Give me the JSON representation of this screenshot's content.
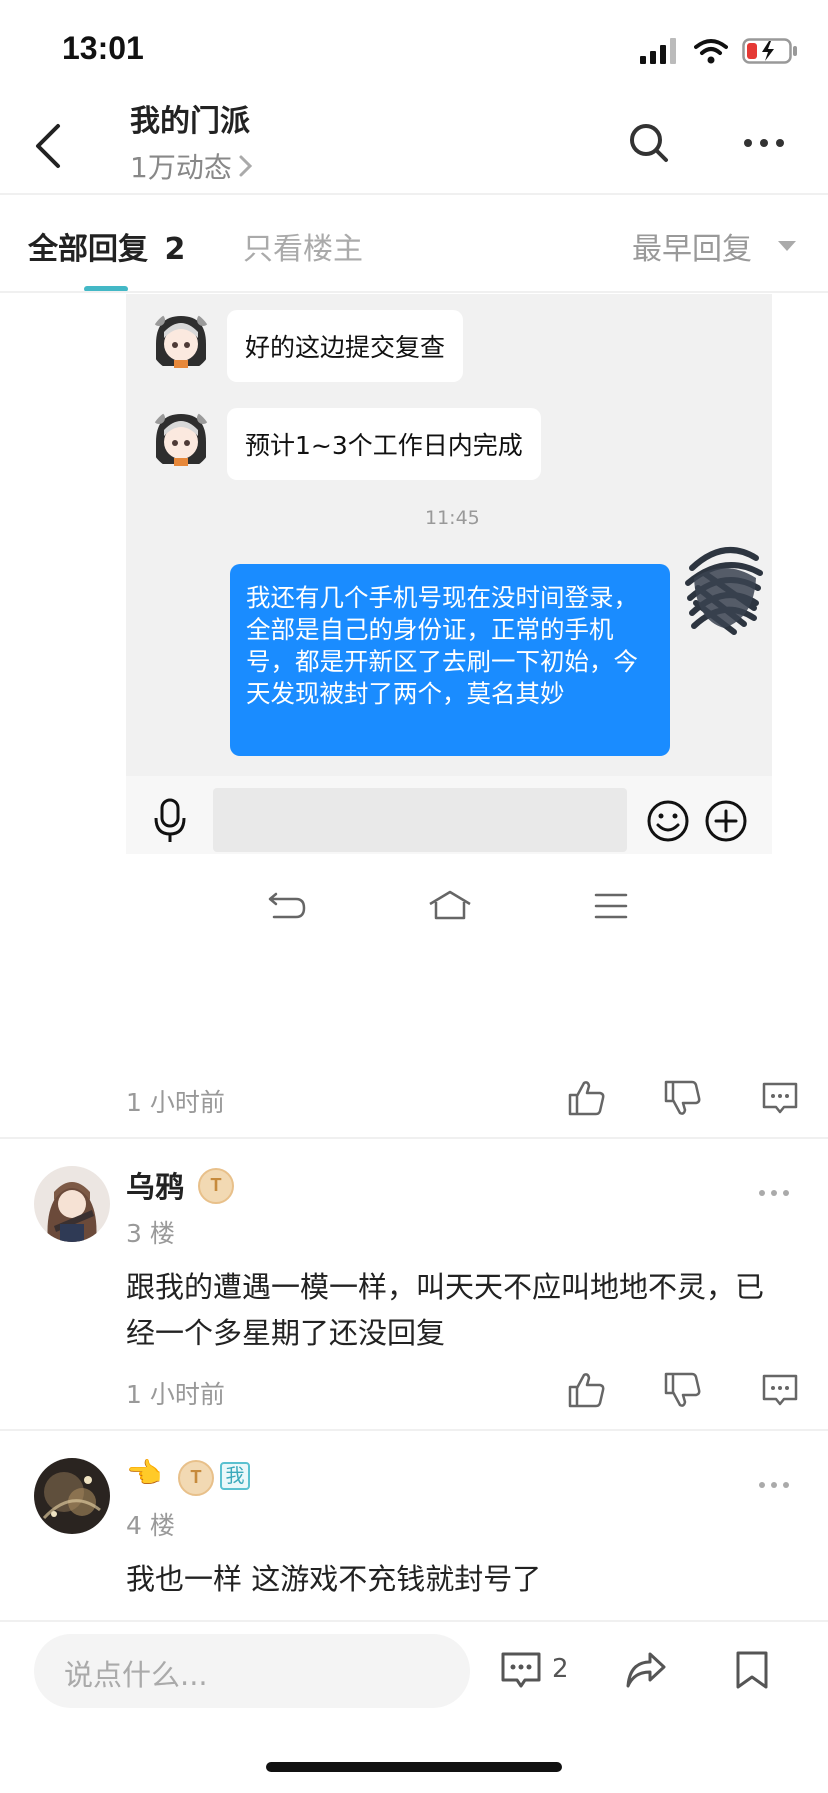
{
  "status_bar": {
    "time": "13:01"
  },
  "header": {
    "title": "我的门派",
    "subtitle": "1万动态"
  },
  "tabs": {
    "all_label": "全部回复",
    "all_count": "2",
    "owner_label": "只看楼主",
    "sort_label": "最早回复"
  },
  "screenshot": {
    "messages": [
      {
        "text": "好的这边提交复查"
      },
      {
        "text": "预计1~3个工作日内完成"
      }
    ],
    "time": "11:45",
    "my_message": "我还有几个手机号现在没时间登录，全部是自己的身份证，正常的手机号，都是开新区了去刷一下初始，今天发现被封了两个，莫名其妙"
  },
  "post_main": {
    "time_ago": "1 小时前"
  },
  "replies": [
    {
      "name": "乌鸦",
      "badge": "T",
      "floor": "3 楼",
      "text": "跟我的遭遇一模一样，叫天天不应叫地地不灵，已经一个多星期了还没回复",
      "time_ago": "1 小时前"
    },
    {
      "name": "👈",
      "badge": "T",
      "me_badge": "我",
      "floor": "4 楼",
      "text": "我也一样 这游戏不充钱就封号了"
    }
  ],
  "bottom_bar": {
    "input_placeholder": "说点什么...",
    "comment_count": "2"
  },
  "colors": {
    "accent": "#43b8c6",
    "bubble_blue": "#1a8cff",
    "battery_low": "#e53935"
  }
}
